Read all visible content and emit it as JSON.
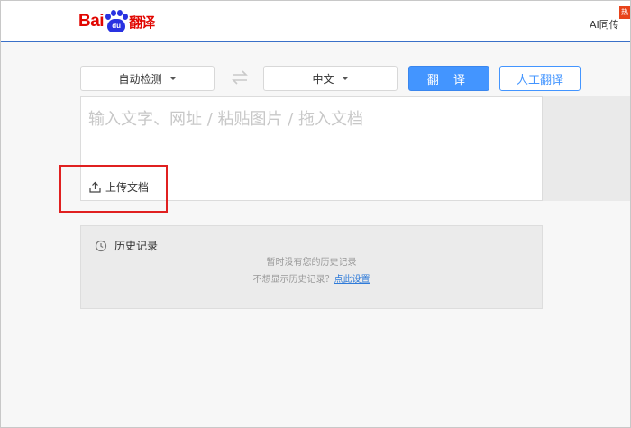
{
  "header": {
    "logo": {
      "bai": "Bai",
      "du": "du",
      "fanyi": "翻译"
    },
    "ai_link": "AI同传",
    "hot_badge": "热"
  },
  "toolbar": {
    "source_lang": "自动检测",
    "target_lang": "中文",
    "translate_label": "翻 译",
    "human_translate_label": "人工翻译"
  },
  "input": {
    "placeholder": "输入文字、网址 / 粘贴图片 / 拖入文档",
    "value": "",
    "upload_label": "上传文档"
  },
  "history": {
    "title": "历史记录",
    "empty_text": "暂时没有您的历史记录",
    "hint_text": "不想显示历史记录？",
    "hint_link": "点此设置"
  },
  "colors": {
    "brand_red": "#e10601",
    "brand_blue": "#2932e1",
    "accent": "#4395ff",
    "highlight_box": "#e02020"
  }
}
